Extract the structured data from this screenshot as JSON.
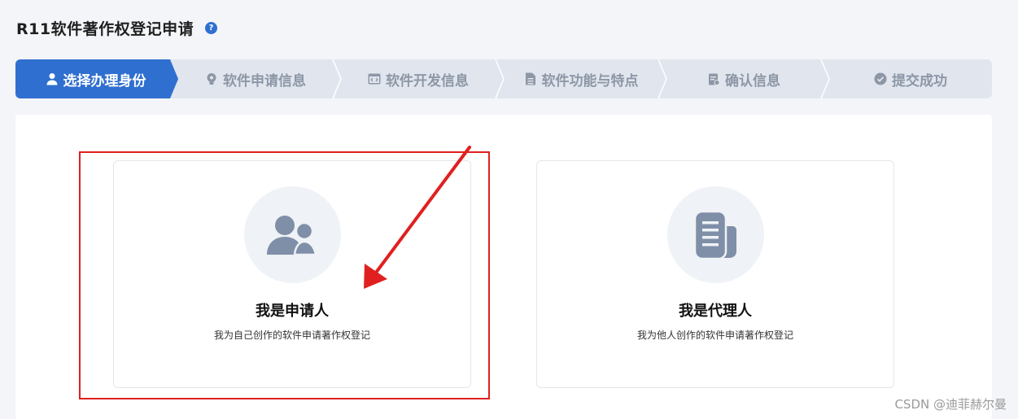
{
  "header": {
    "title": "R11软件著作权登记申请",
    "help_icon": "question-circle-icon",
    "help_glyph": "?"
  },
  "steps": [
    {
      "label": "选择办理身份",
      "icon": "user-icon",
      "active": true
    },
    {
      "label": "软件申请信息",
      "icon": "lightbulb-icon",
      "active": false
    },
    {
      "label": "软件开发信息",
      "icon": "code-window-icon",
      "active": false
    },
    {
      "label": "软件功能与特点",
      "icon": "document-icon",
      "active": false
    },
    {
      "label": "确认信息",
      "icon": "clipboard-icon",
      "active": false
    },
    {
      "label": "提交成功",
      "icon": "check-circle-icon",
      "active": false
    }
  ],
  "cards": [
    {
      "title": "我是申请人",
      "desc": "我为自己创作的软件申请著作权登记",
      "icon": "users-icon"
    },
    {
      "title": "我是代理人",
      "desc": "我为他人创作的软件申请著作权登记",
      "icon": "document-stack-icon"
    }
  ],
  "annotation": {
    "color": "#e02020"
  },
  "colors": {
    "active_step": "#2f6fd0",
    "inactive_step": "#e1e6ee",
    "icon_gray": "#7f8fa8"
  },
  "watermark": "CSDN @迪菲赫尔曼"
}
